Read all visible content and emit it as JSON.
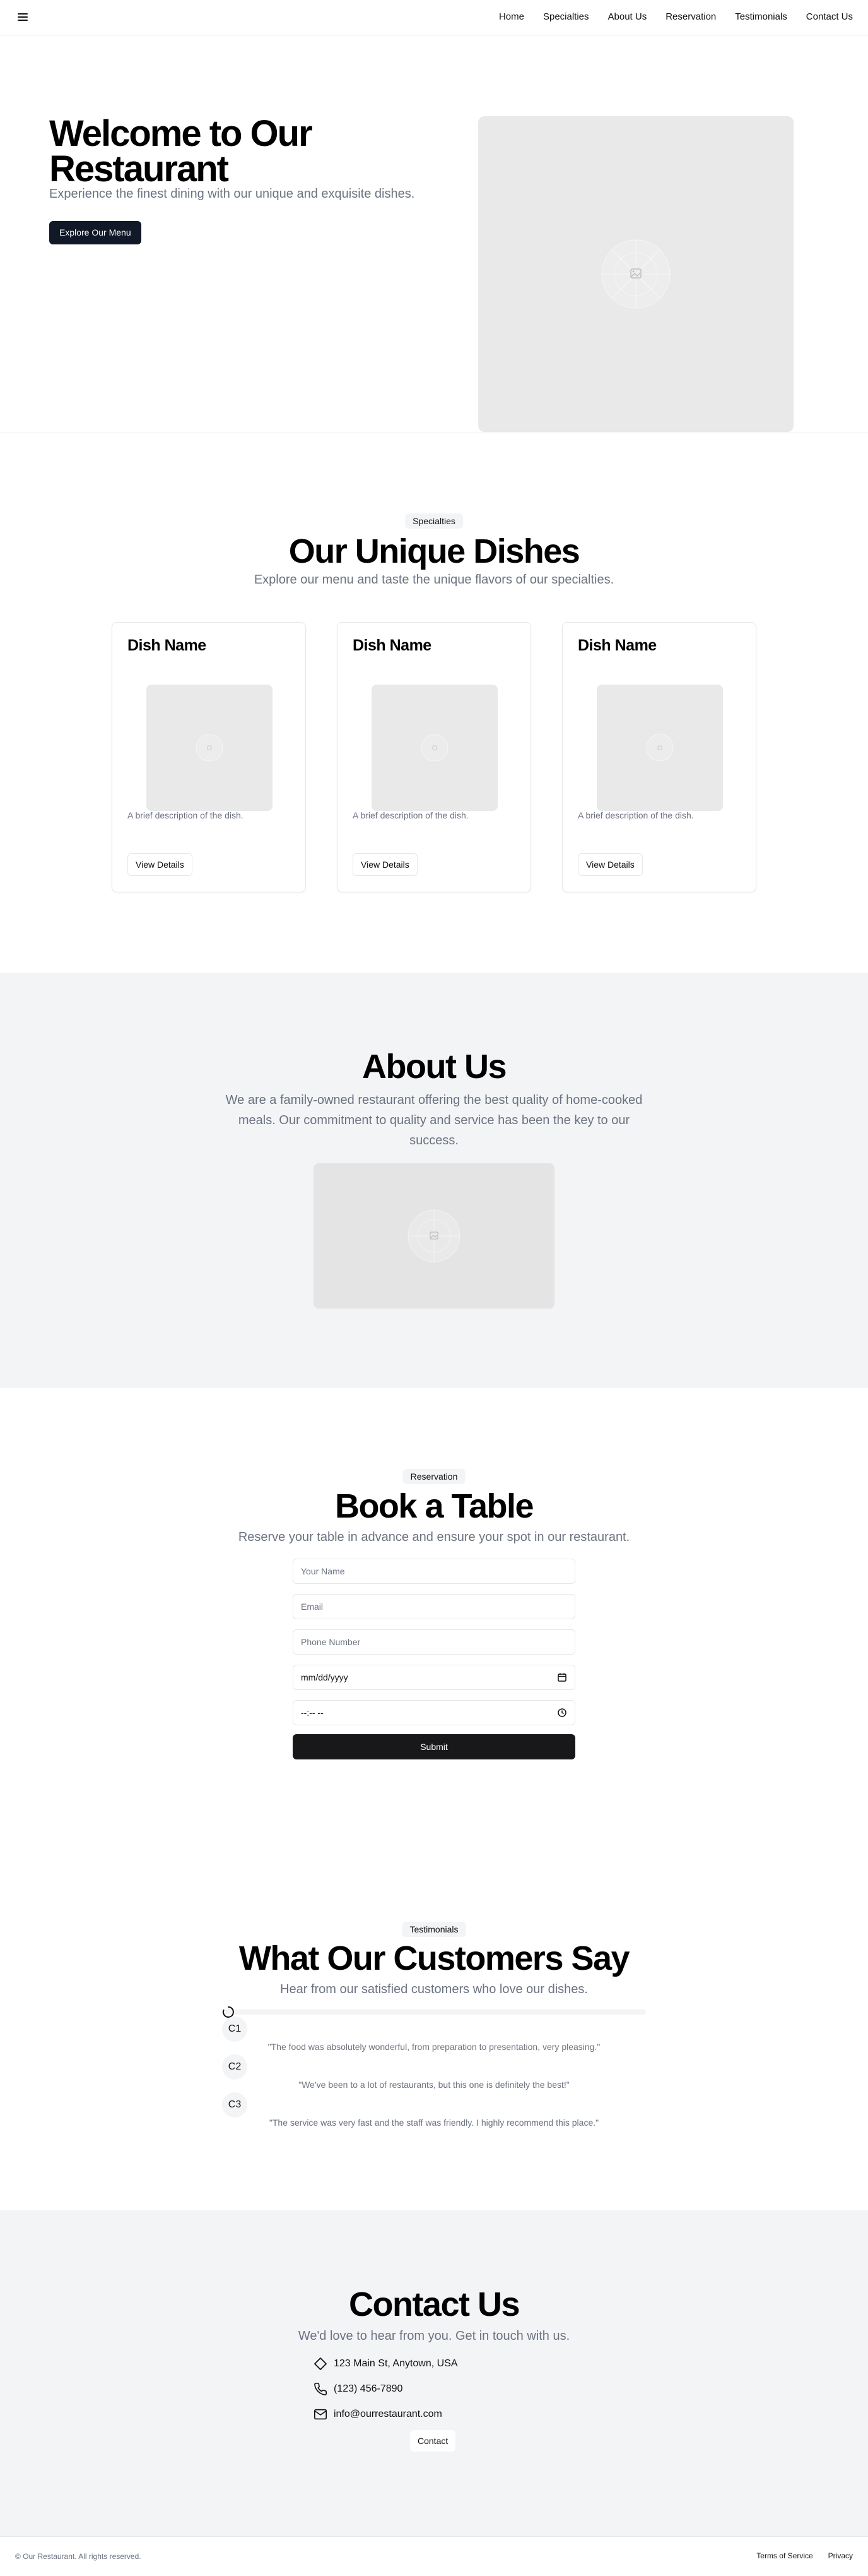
{
  "header": {
    "menu_icon": "hamburger-menu-icon",
    "nav": [
      "Home",
      "Specialties",
      "About Us",
      "Reservation",
      "Testimonials",
      "Contact Us"
    ]
  },
  "hero": {
    "title": "Welcome to Our Restaurant",
    "subtitle": "Experience the finest dining with our unique and exquisite dishes.",
    "cta": "Explore Our Menu",
    "image_icon": "image-placeholder-icon"
  },
  "specialties": {
    "badge": "Specialties",
    "title": "Our Unique Dishes",
    "subtitle": "Explore our menu and taste the unique flavors of our specialties.",
    "cards": [
      {
        "title": "Dish Name",
        "description": "A brief description of the dish.",
        "button": "View Details"
      },
      {
        "title": "Dish Name",
        "description": "A brief description of the dish.",
        "button": "View Details"
      },
      {
        "title": "Dish Name",
        "description": "A brief description of the dish.",
        "button": "View Details"
      }
    ]
  },
  "about": {
    "title": "About Us",
    "text": "We are a family-owned restaurant offering the best quality of home-cooked meals. Our commitment to quality and service has been the key to our success."
  },
  "reservation": {
    "badge": "Reservation",
    "title": "Book a Table",
    "subtitle": "Reserve your table in advance and ensure your spot in our restaurant.",
    "fields": {
      "name_placeholder": "Your Name",
      "email_placeholder": "Email",
      "phone_placeholder": "Phone Number",
      "date_value": "mm/dd/yyyy",
      "time_value": "--:-- --"
    },
    "submit": "Submit"
  },
  "testimonials": {
    "badge": "Testimonials",
    "title": "What Our Customers Say",
    "subtitle": "Hear from our satisfied customers who love our dishes.",
    "items": [
      {
        "avatar": "C1",
        "quote": "\"The food was absolutely wonderful, from preparation to presentation, very pleasing.\""
      },
      {
        "avatar": "C2",
        "quote": "\"We've been to a lot of restaurants, but this one is definitely the best!\""
      },
      {
        "avatar": "C3",
        "quote": "\"The service was very fast and the staff was friendly. I highly recommend this place.\""
      }
    ]
  },
  "contact": {
    "title": "Contact Us",
    "subtitle": "We'd love to hear from you. Get in touch with us.",
    "address": "123 Main St, Anytown, USA",
    "phone": "(123) 456-7890",
    "email": "info@ourrestaurant.com",
    "button": "Contact"
  },
  "footer": {
    "copyright": "© Our Restaurant. All rights reserved.",
    "links": [
      "Terms of Service",
      "Privacy"
    ]
  }
}
